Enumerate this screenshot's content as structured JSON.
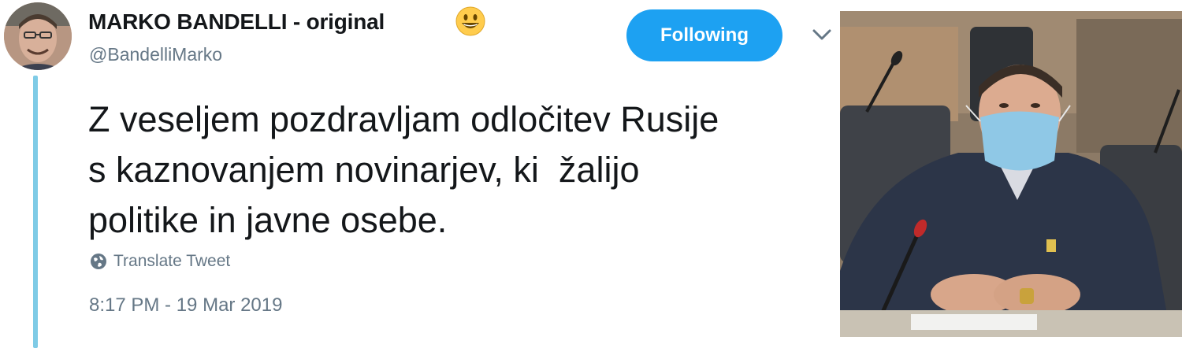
{
  "tweet": {
    "display_name": "MARKO BANDELLI - original",
    "emoji": "grinning-face-emoji",
    "handle": "@BandelliMarko",
    "follow_button_label": "Following",
    "text": "Z veseljem pozdravljam odločitev Rusije\ns kaznovanjem novinarjev, ki  žalijo\npolitike in javne osebe.",
    "translate_label": "Translate Tweet",
    "timestamp": "8:17 PM - 19 Mar 2019",
    "icons": {
      "avatar": "avatar",
      "emoji": "grinning-face-icon",
      "menu": "chevron-down-icon",
      "translate": "globe-icon"
    },
    "colors": {
      "accent": "#1da1f2",
      "thread_line": "#7fcbe6",
      "secondary_text": "#657786",
      "primary_text": "#14171a"
    }
  },
  "photo": {
    "subject": "man-wearing-face-mask-at-microphone"
  }
}
